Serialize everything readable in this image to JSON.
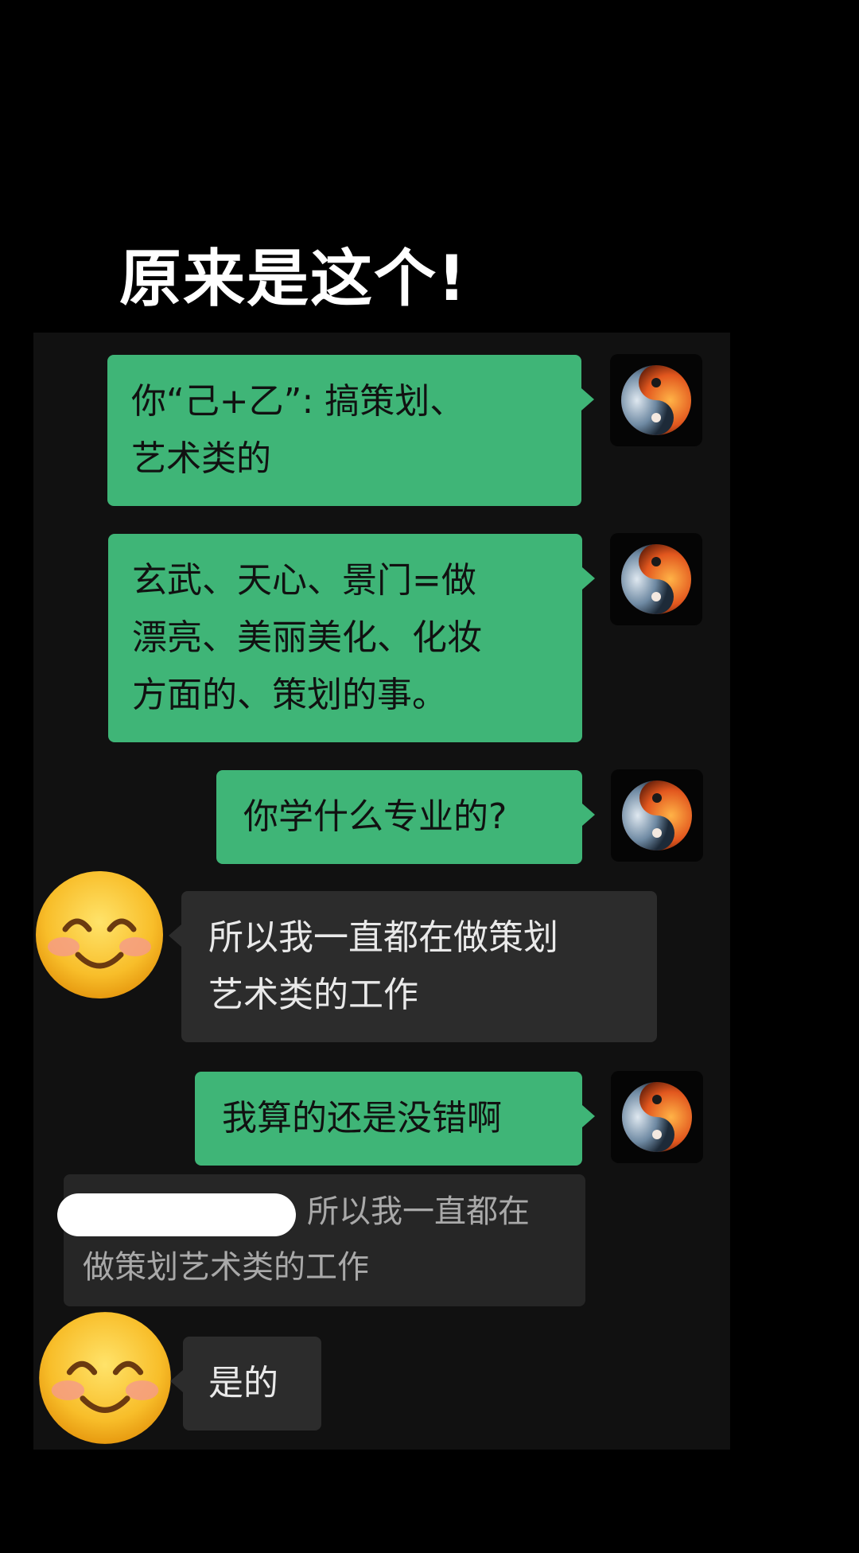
{
  "caption": "原来是这个!",
  "messages": [
    {
      "text": "你“己+乙”: 搞策划、\n艺术类的"
    },
    {
      "text": "玄武、天心、景门=做\n漂亮、美丽美化、化妆\n方面的、策划的事。"
    },
    {
      "text": "你学什么专业的?"
    },
    {
      "text": "所以我一直都在做策划\n艺术类的工作"
    },
    {
      "text": "我算的还是没错啊"
    },
    {
      "quote": "所以我一直都在\n做策划艺术类的工作"
    },
    {
      "text": "是的"
    }
  ],
  "icons": {
    "sender_avatar": "yin-yang-icon",
    "receiver_avatar": "smiling-face-emoji-icon"
  },
  "colors": {
    "outgoing_bubble": "#3fb577",
    "incoming_bubble": "#2c2c2c",
    "panel": "#111111",
    "background": "#000000"
  }
}
